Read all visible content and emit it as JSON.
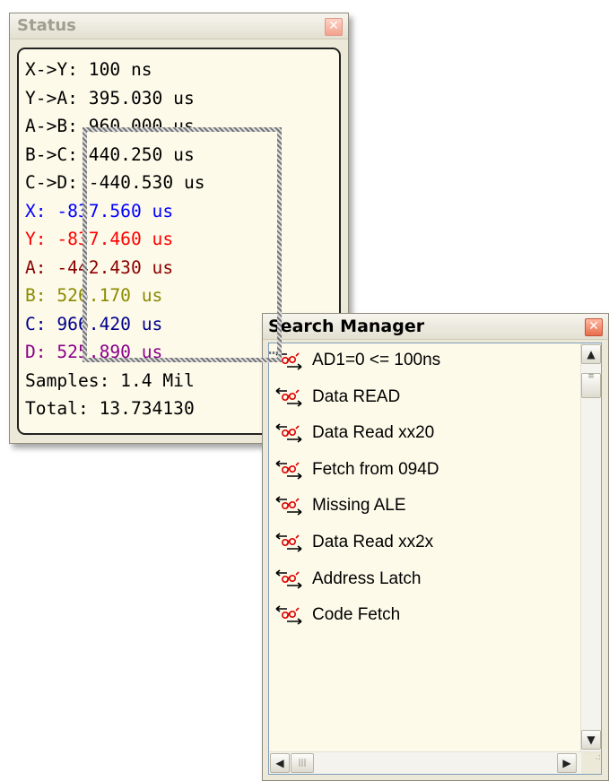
{
  "status": {
    "title": "Status",
    "close_label": "✕",
    "lines": [
      {
        "text": "X->Y: 100 ns",
        "color": "#000000"
      },
      {
        "text": "Y->A: 395.030 us",
        "color": "#000000"
      },
      {
        "text": "A->B: 960.000 us",
        "color": "#000000"
      },
      {
        "text": "B->C: 440.250 us",
        "color": "#000000"
      },
      {
        "text": "C->D: -440.530 us",
        "color": "#000000"
      },
      {
        "text": "X: -837.560 us",
        "color": "#0000ff"
      },
      {
        "text": "Y: -837.460 us",
        "color": "#ff0000"
      },
      {
        "text": "A: -442.430 us",
        "color": "#8b0000"
      },
      {
        "text": "B: 526.170 us",
        "color": "#8b8b00"
      },
      {
        "text": "C: 966.420 us",
        "color": "#00008b"
      },
      {
        "text": "D: 525.890 us",
        "color": "#8b008b"
      },
      {
        "text": "Samples: 1.4 Mil",
        "color": "#000000"
      },
      {
        "text": "Total: 13.734130",
        "color": "#000000"
      }
    ]
  },
  "search_manager": {
    "title": "Search Manager",
    "close_label": "✕",
    "items": [
      {
        "label": "AD1=0 <= 100ns",
        "icon": "search-arrows-icon"
      },
      {
        "label": "Data READ",
        "icon": "search-arrows-icon"
      },
      {
        "label": "Data Read xx20",
        "icon": "search-arrows-icon"
      },
      {
        "label": "Fetch from 094D",
        "icon": "search-arrows-icon"
      },
      {
        "label": "Missing ALE",
        "icon": "search-arrows-icon"
      },
      {
        "label": "Data Read xx2x",
        "icon": "search-arrows-icon"
      },
      {
        "label": "Address Latch",
        "icon": "search-arrows-icon"
      },
      {
        "label": "Code Fetch",
        "icon": "search-arrows-icon"
      }
    ],
    "scroll_up": "▲",
    "scroll_down": "▼",
    "scroll_left": "◀",
    "scroll_right": "▶"
  },
  "colors": {
    "panel_background": "#fdfaea",
    "window_chrome": "#ece9d8",
    "close_button": "#e96d4c"
  }
}
